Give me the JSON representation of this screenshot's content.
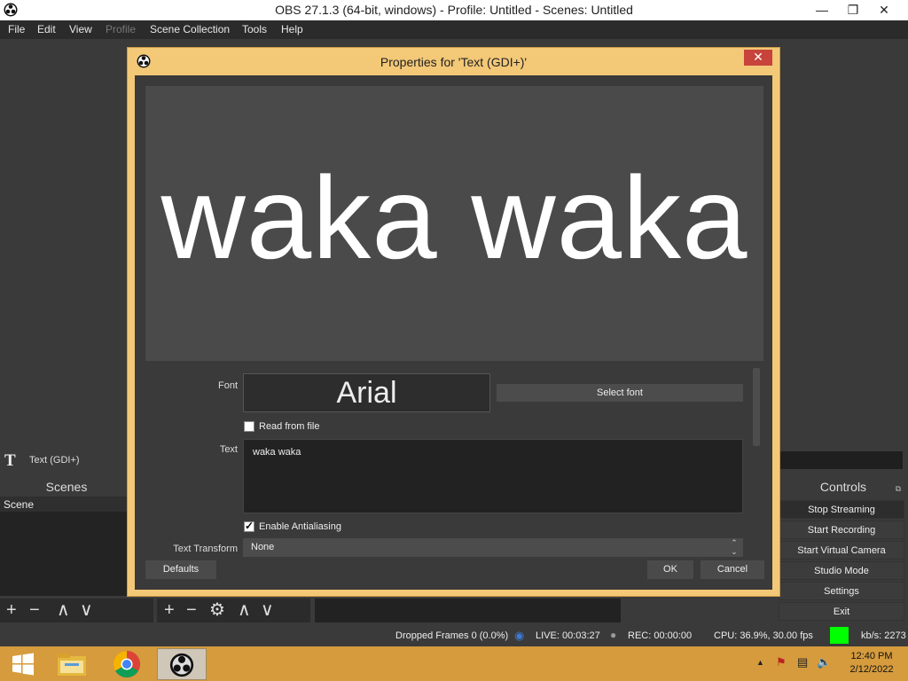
{
  "window": {
    "title": "OBS 27.1.3 (64-bit, windows) - Profile: Untitled - Scenes: Untitled",
    "minimize_glyph": "—",
    "restore_glyph": "❐",
    "close_glyph": "✕"
  },
  "menu": {
    "items": [
      "File",
      "Edit",
      "View",
      "Profile",
      "Scene Collection",
      "Tools",
      "Help"
    ],
    "disabled": [
      "Profile"
    ]
  },
  "sources": {
    "selected_icon": "T",
    "selected_label": "Text (GDI+)"
  },
  "scenes": {
    "header": "Scenes",
    "items": [
      "Scene"
    ]
  },
  "controls": {
    "header": "Controls",
    "float_glyph": "⧉",
    "buttons": [
      "Stop Streaming",
      "Start Recording",
      "Start Virtual Camera",
      "Studio Mode",
      "Settings",
      "Exit"
    ]
  },
  "toolbars": {
    "scenes": [
      "+",
      "−",
      "∧",
      "∨"
    ],
    "sources": [
      "+",
      "−",
      "⚙",
      "∧",
      "∨"
    ]
  },
  "status": {
    "dropped_frames": "Dropped Frames 0 (0.0%)",
    "live": "LIVE: 00:03:27",
    "rec": "REC: 00:00:00",
    "cpu": "CPU: 36.9%, 30.00 fps",
    "kbps": "kb/s: 2273",
    "live_icon_glyph": "◉",
    "rec_icon_glyph": "●",
    "stream_health_color": "#00ff00"
  },
  "taskbar": {
    "time": "12:40 PM",
    "date": "2/12/2022",
    "tray_glyphs": [
      "▲",
      "⚑",
      "▤",
      "🔈"
    ]
  },
  "dialog": {
    "title": "Properties for 'Text (GDI+)'",
    "close_glyph": "✕",
    "preview_text": "waka waka",
    "font_label": "Font",
    "font_value": "Arial",
    "select_font_label": "Select font",
    "read_from_file_label": "Read from file",
    "read_from_file_checked": false,
    "text_label": "Text",
    "text_value": "waka waka",
    "antialiasing_label": "Enable Antialiasing",
    "antialiasing_checked": true,
    "transform_label": "Text Transform",
    "transform_value": "None",
    "select_arrows": "⌃⌄",
    "defaults_label": "Defaults",
    "ok_label": "OK",
    "cancel_label": "Cancel"
  }
}
